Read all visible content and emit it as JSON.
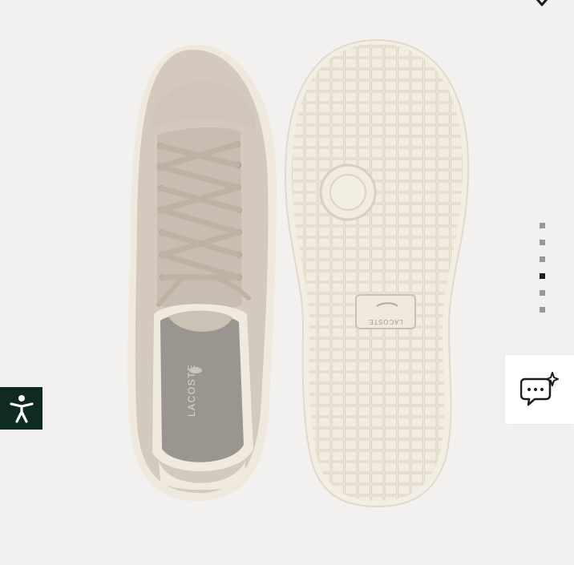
{
  "product": {
    "image_alt": "Lacoste sneaker, top view and outsole",
    "insole_brand_text": "LACOSTE",
    "sole_brand_text": "LACOSTE",
    "upper_color": "#d2c9bf",
    "sole_color": "#efe8dc"
  },
  "gallery": {
    "slide_count": 6,
    "active_slide": 4
  },
  "widgets": {
    "accessibility_label": "Accessibility",
    "chat_label": "Chat"
  },
  "colors": {
    "background": "#f2f1f0",
    "accessibility_bg": "#0f2a1e",
    "dot_inactive": "#9a9896",
    "dot_active": "#1f1f1f"
  }
}
